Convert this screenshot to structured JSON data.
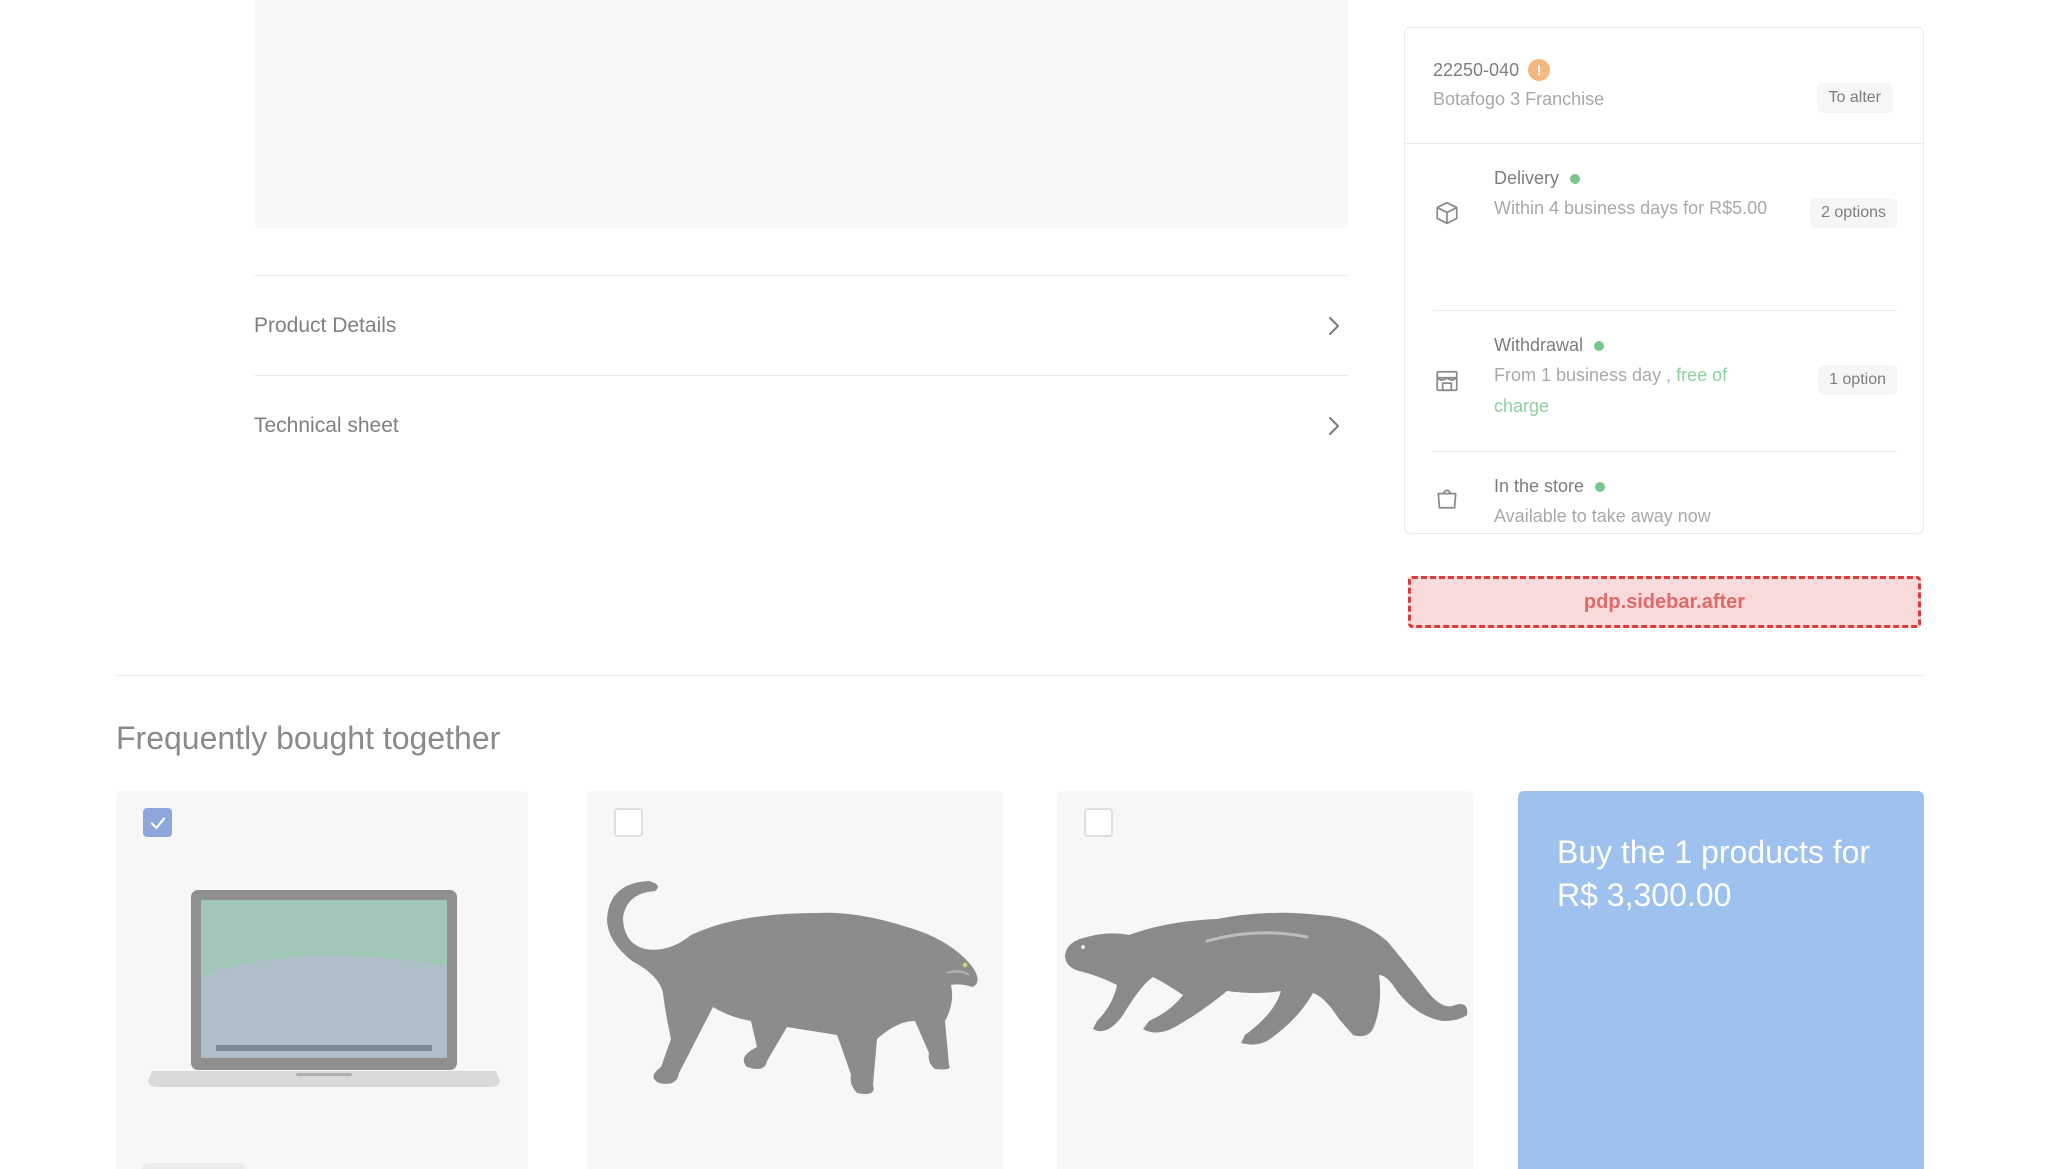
{
  "accordions": [
    {
      "title": "Product Details"
    },
    {
      "title": "Technical sheet"
    }
  ],
  "sidebar": {
    "store": {
      "code": "22250-040",
      "name": "Botafogo 3 Franchise",
      "alter_label": "To alter",
      "warning_icon": "exclamation-icon",
      "warning_color": "#f2b87f"
    },
    "options": {
      "delivery": {
        "title": "Delivery",
        "description": "Within 4 business days for R$5.00",
        "badge": "2 options",
        "icon": "box-icon"
      },
      "withdrawal": {
        "title": "Withdrawal",
        "description_prefix": "From 1 business day ,",
        "description_highlight": "free of charge",
        "badge": "1 option",
        "icon": "storefront-icon"
      },
      "store": {
        "title": "In the store",
        "description": "Available to take away now",
        "icon": "shopping-bag-icon"
      }
    },
    "status_color": "#79c68c"
  },
  "extension_point": {
    "label": "pdp.sidebar.after"
  },
  "frequently_bought": {
    "title": "Frequently bought together",
    "products": [
      {
        "checked": true,
        "image": "laptop"
      },
      {
        "checked": false,
        "image": "black-panther-statue"
      },
      {
        "checked": false,
        "image": "black-panther-figurine"
      }
    ],
    "buy_label": "Buy the 1 products for R$ 3,300.00",
    "buy_color": "#9ec1ee"
  }
}
